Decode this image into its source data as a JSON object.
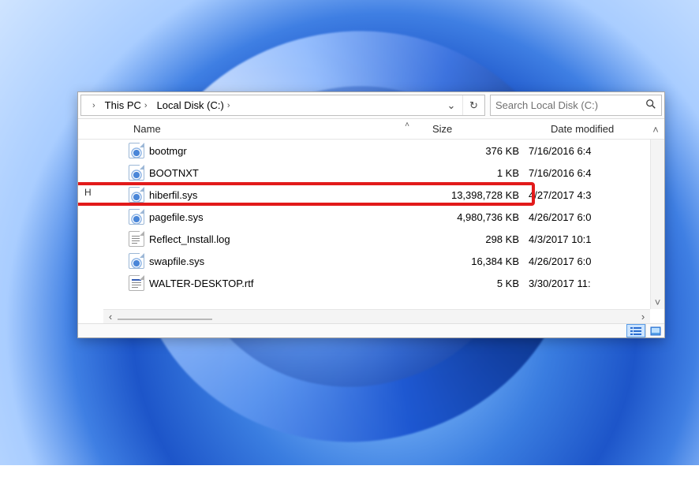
{
  "breadcrumb": {
    "items": [
      {
        "label": "This PC"
      },
      {
        "label": "Local Disk (C:)"
      }
    ]
  },
  "search": {
    "placeholder": "Search Local Disk (C:)"
  },
  "columns": {
    "name": "Name",
    "size": "Size",
    "date": "Date modified"
  },
  "files": [
    {
      "name": "bootmgr",
      "size": "376 KB",
      "date": "7/16/2016 6:4",
      "icon": "sys"
    },
    {
      "name": "BOOTNXT",
      "size": "1 KB",
      "date": "7/16/2016 6:4",
      "icon": "sys"
    },
    {
      "name": "hiberfil.sys",
      "size": "13,398,728 KB",
      "date": "4/27/2017 4:3",
      "icon": "sys",
      "highlight": true
    },
    {
      "name": "pagefile.sys",
      "size": "4,980,736 KB",
      "date": "4/26/2017 6:0",
      "icon": "sys"
    },
    {
      "name": "Reflect_Install.log",
      "size": "298 KB",
      "date": "4/3/2017 10:1",
      "icon": "txt"
    },
    {
      "name": "swapfile.sys",
      "size": "16,384 KB",
      "date": "4/26/2017 6:0",
      "icon": "sys"
    },
    {
      "name": "WALTER-DESKTOP.rtf",
      "size": "5 KB",
      "date": "3/30/2017 11:",
      "icon": "rtf"
    }
  ],
  "nav_tree_letter": "H"
}
